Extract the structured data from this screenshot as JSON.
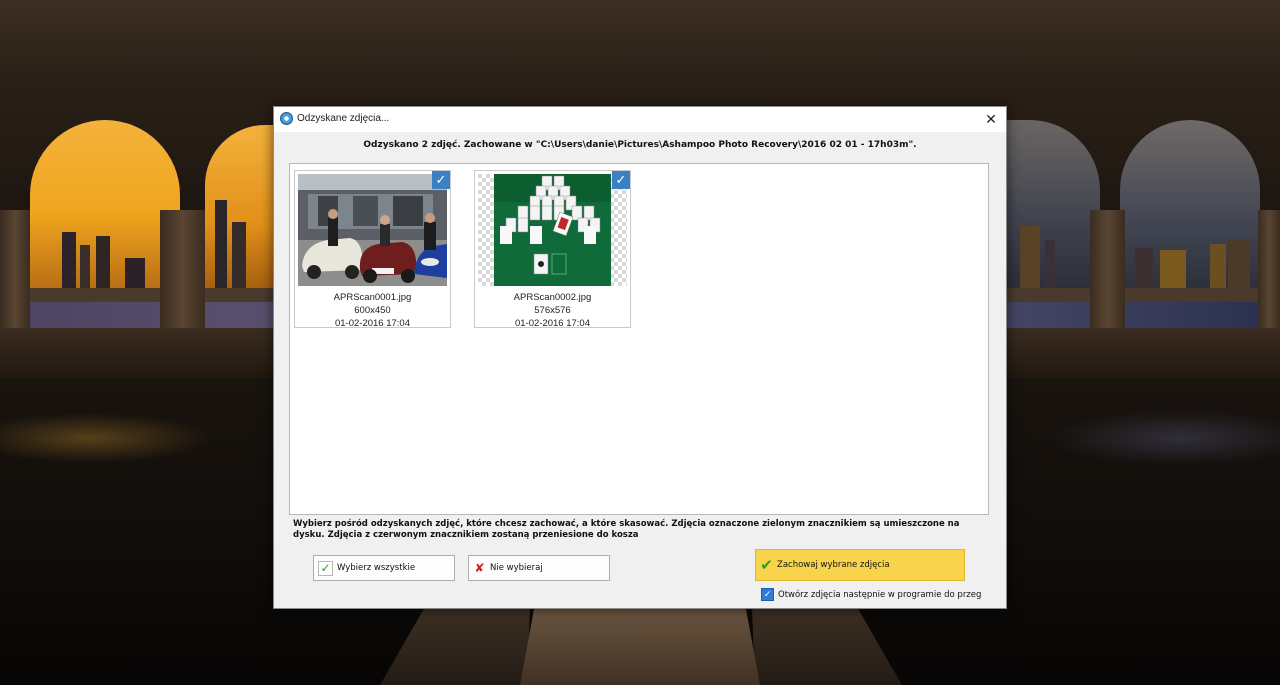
{
  "window": {
    "title": "Odzyskane zdjęcia...",
    "close_glyph": "✕"
  },
  "header": {
    "message": "Odzyskano 2 zdjęć. Zachowane w \"C:\\Users\\danie\\Pictures\\Ashampoo Photo Recovery\\2016 02 01 - 17h03m\"."
  },
  "photos": [
    {
      "filename": "APRScan0001.jpg",
      "dimensions": "600x450",
      "date": "01-02-2016 17:04",
      "checked": true
    },
    {
      "filename": "APRScan0002.jpg",
      "dimensions": "576x576",
      "date": "01-02-2016 17:04",
      "checked": true
    }
  ],
  "description": "Wybierz pośród odzyskanych zdjęć, które chcesz zachować, a które skasować. Zdjęcia oznaczone zielonym znacznikiem są umieszczone na dysku. Zdjęcia z czerwonym znacznikiem zostaną przeniesione do kosza",
  "buttons": {
    "select_all": "Wybierz wszystkie",
    "select_none": "Nie wybieraj",
    "save_selected": "Zachowaj wybrane zdjęcia"
  },
  "open_option": {
    "label": "Otwórz zdjęcia następnie w programie do przeg",
    "checked": true
  },
  "icons": {
    "app": "photo-recovery-icon",
    "check": "checkmark-icon",
    "cross": "red-x-icon"
  },
  "colors": {
    "accent": "#3b7fc4",
    "save_button": "#f8d44c",
    "check_green": "#2a9d2a",
    "cross_red": "#d42020"
  }
}
